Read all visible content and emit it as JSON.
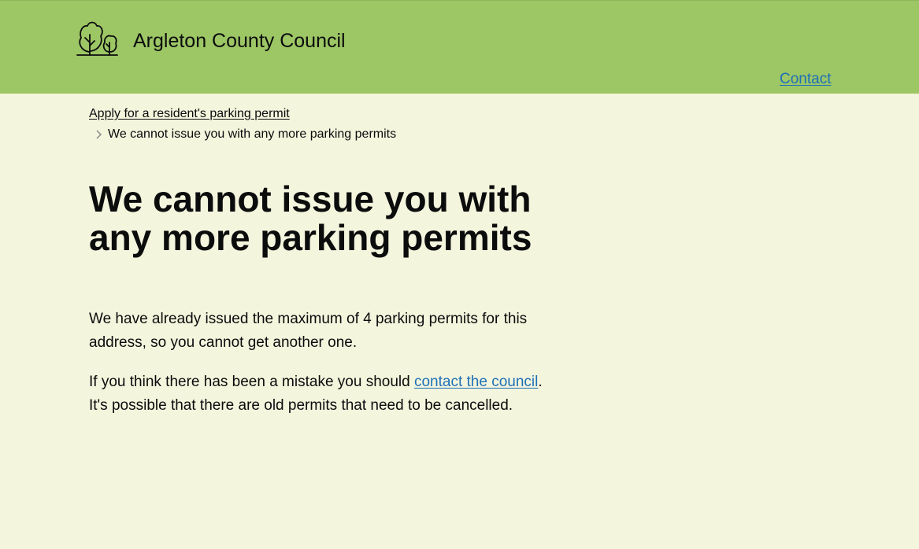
{
  "header": {
    "service_name": "Argleton County Council",
    "logo_icon": "tree-icon",
    "nav": {
      "contact_label": "Contact"
    },
    "colors": {
      "background": "#9dc665"
    }
  },
  "breadcrumb": {
    "parent_label": "Apply for a resident's parking permit",
    "separator_icon": "chevron-right-icon",
    "current_label": "We cannot issue you with any more parking permits"
  },
  "main": {
    "title": "We cannot issue you with any more parking permits",
    "paragraph_1": "We have already issued the maximum of 4 parking permits for this address, so you cannot get another one.",
    "paragraph_2": {
      "before_link": "If you think there has been a mistake you should ",
      "link_label": "contact the council",
      "after_link": ". It's possible that there are old permits that need to be cancelled."
    }
  },
  "colors": {
    "page_background": "#f4f5dd",
    "link": "#1d70b8",
    "text": "#0b0c0c"
  }
}
